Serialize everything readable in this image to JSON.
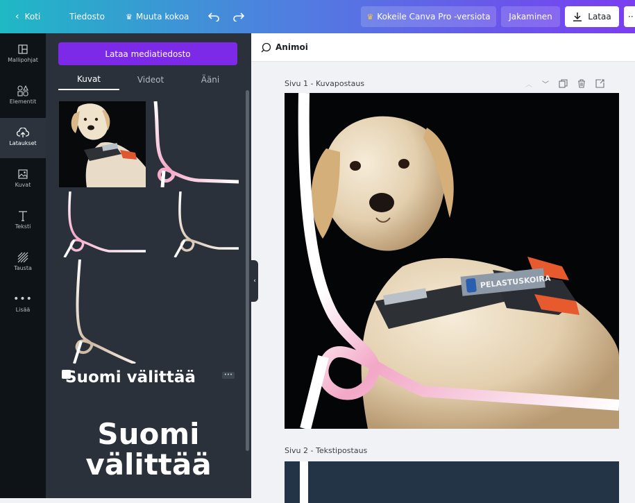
{
  "topbar": {
    "home_label": "Koti",
    "file_label": "Tiedosto",
    "resize_label": "Muuta kokoa",
    "pro_label": "Kokeile Canva Pro -versiota",
    "share_label": "Jakaminen",
    "download_label": "Lataa",
    "more_label": "··"
  },
  "rail": {
    "items": [
      {
        "label": "Mallipohjat",
        "icon": "template-icon"
      },
      {
        "label": "Elementit",
        "icon": "elements-icon"
      },
      {
        "label": "Lataukset",
        "icon": "upload-cloud-icon"
      },
      {
        "label": "Kuvat",
        "icon": "image-icon"
      },
      {
        "label": "Teksti",
        "icon": "text-icon"
      },
      {
        "label": "Tausta",
        "icon": "background-icon"
      },
      {
        "label": "Lisää",
        "icon": "more-dots-icon"
      }
    ]
  },
  "panel": {
    "upload_button": "Lataa mediatiedosto",
    "tabs": [
      "Kuvat",
      "Videot",
      "Ääni"
    ],
    "brand_small": "Suomi välittää",
    "brand_big_line1": "Suomi",
    "brand_big_line2": "välittää"
  },
  "editor": {
    "animate_label": "Animoi",
    "page1_label": "Sivu 1 - Kuvapostaus",
    "page2_label": "Sivu 2 - Tekstipostaus",
    "vest_text": "PELASTUSKOIRA"
  },
  "colors": {
    "accent_purple": "#7d2ae8",
    "panel_bg": "#2a313a",
    "rail_bg": "#0e1318",
    "pink": "#f2a7c6"
  }
}
